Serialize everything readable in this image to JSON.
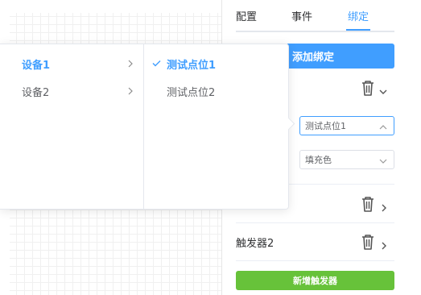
{
  "tabs": [
    {
      "label": "配置",
      "active": false
    },
    {
      "label": "事件",
      "active": false
    },
    {
      "label": "绑定",
      "active": true
    }
  ],
  "binding": {
    "add_binding_label": "添加绑定",
    "point_select_value": "测试点位1",
    "property_select_value": "填充色"
  },
  "triggers": [
    {
      "label": ""
    },
    {
      "label": "触发器2"
    }
  ],
  "add_trigger_label": "新增触发器",
  "cascader": {
    "devices": [
      {
        "label": "设备1",
        "active": true
      },
      {
        "label": "设备2",
        "active": false
      }
    ],
    "points": [
      {
        "label": "测试点位1",
        "selected": true
      },
      {
        "label": "测试点位2",
        "selected": false
      }
    ]
  },
  "colors": {
    "primary": "#409eff",
    "success": "#67c23a",
    "text": "#303133",
    "muted": "#606266"
  },
  "icons": [
    "trash-icon",
    "chevron-down-icon",
    "chevron-right-icon",
    "chevron-up-icon",
    "check-icon"
  ]
}
